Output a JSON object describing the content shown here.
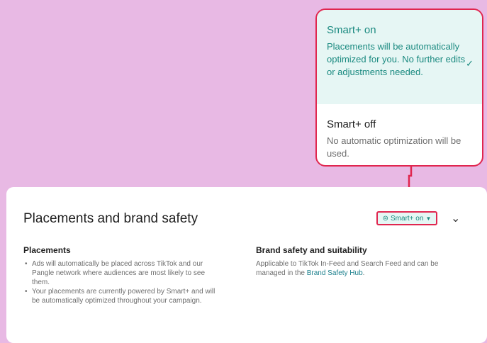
{
  "popup": {
    "smart_on_title": "Smart+ on",
    "smart_on_desc": "Placements will be automatically optimized for you. No further edits or adjustments needed.",
    "smart_off_title": "Smart+ off",
    "smart_off_desc": "No automatic optimization will be used.",
    "selected_icon": "check-icon"
  },
  "card": {
    "title": "Placements and brand safety",
    "smart_badge_label": "Smart+ on",
    "placements_heading": "Placements",
    "placements_bullets": [
      "Ads will automatically be placed across TikTok and our Pangle network where audiences are most likely to see them.",
      "Your placements are currently powered by Smart+ and will be automatically optimized throughout your campaign."
    ],
    "brand_heading": "Brand safety and suitability",
    "brand_text_prefix": "Applicable to TikTok In-Feed and Search Feed and can be managed in the ",
    "brand_link": "Brand Safety Hub",
    "brand_text_suffix": "."
  },
  "colors": {
    "background": "#e8b9e4",
    "accent": "#1b8a80",
    "highlight_border": "#e0264f",
    "selected_bg": "#e6f6f4"
  }
}
